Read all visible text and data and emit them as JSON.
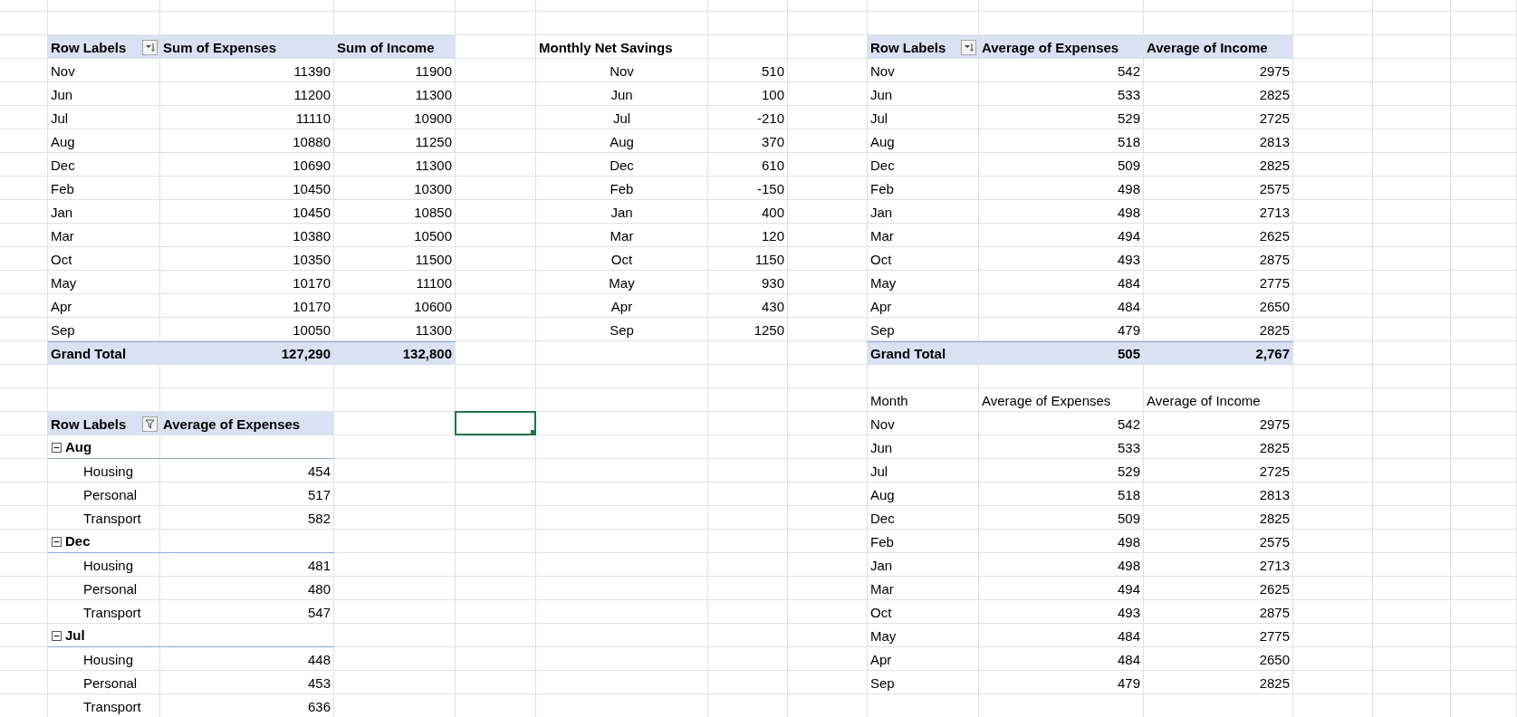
{
  "pivot_sum": {
    "columns": [
      "Row Labels",
      "Sum of Expenses",
      "Sum of Income"
    ],
    "header_button": {
      "kind": "sort"
    },
    "rows": [
      [
        "Nov",
        "11390",
        "11900"
      ],
      [
        "Jun",
        "11200",
        "11300"
      ],
      [
        "Jul",
        "11110",
        "10900"
      ],
      [
        "Aug",
        "10880",
        "11250"
      ],
      [
        "Dec",
        "10690",
        "11300"
      ],
      [
        "Feb",
        "10450",
        "10300"
      ],
      [
        "Jan",
        "10450",
        "10850"
      ],
      [
        "Mar",
        "10380",
        "10500"
      ],
      [
        "Oct",
        "10350",
        "11500"
      ],
      [
        "May",
        "10170",
        "11100"
      ],
      [
        "Apr",
        "10170",
        "10600"
      ],
      [
        "Sep",
        "10050",
        "11300"
      ]
    ],
    "total": [
      "Grand Total",
      "127,290",
      "132,800"
    ]
  },
  "net_savings": {
    "title": "Monthly Net Savings",
    "rows": [
      [
        "Nov",
        "510"
      ],
      [
        "Jun",
        "100"
      ],
      [
        "Jul",
        "-210"
      ],
      [
        "Aug",
        "370"
      ],
      [
        "Dec",
        "610"
      ],
      [
        "Feb",
        "-150"
      ],
      [
        "Jan",
        "400"
      ],
      [
        "Mar",
        "120"
      ],
      [
        "Oct",
        "1150"
      ],
      [
        "May",
        "930"
      ],
      [
        "Apr",
        "430"
      ],
      [
        "Sep",
        "1250"
      ]
    ]
  },
  "pivot_avg": {
    "columns": [
      "Row Labels",
      "Average of Expenses",
      "Average of Income"
    ],
    "header_button": {
      "kind": "sort"
    },
    "rows": [
      [
        "Nov",
        "542",
        "2975"
      ],
      [
        "Jun",
        "533",
        "2825"
      ],
      [
        "Jul",
        "529",
        "2725"
      ],
      [
        "Aug",
        "518",
        "2813"
      ],
      [
        "Dec",
        "509",
        "2825"
      ],
      [
        "Feb",
        "498",
        "2575"
      ],
      [
        "Jan",
        "498",
        "2713"
      ],
      [
        "Mar",
        "494",
        "2625"
      ],
      [
        "Oct",
        "493",
        "2875"
      ],
      [
        "May",
        "484",
        "2775"
      ],
      [
        "Apr",
        "484",
        "2650"
      ],
      [
        "Sep",
        "479",
        "2825"
      ]
    ],
    "total": [
      "Grand Total",
      "505",
      "2,767"
    ]
  },
  "pivot_category": {
    "columns": [
      "Row Labels",
      "Average of Expenses"
    ],
    "header_button": {
      "kind": "filter"
    },
    "groups": [
      {
        "label": "Aug",
        "expanded": true,
        "children": [
          [
            "Housing",
            "454"
          ],
          [
            "Personal",
            "517"
          ],
          [
            "Transport",
            "582"
          ]
        ]
      },
      {
        "label": "Dec",
        "expanded": true,
        "children": [
          [
            "Housing",
            "481"
          ],
          [
            "Personal",
            "480"
          ],
          [
            "Transport",
            "547"
          ]
        ]
      },
      {
        "label": "Jul",
        "expanded": true,
        "children": [
          [
            "Housing",
            "448"
          ],
          [
            "Personal",
            "453"
          ],
          [
            "Transport",
            "636"
          ]
        ]
      }
    ]
  },
  "month_table": {
    "columns": [
      "Month",
      "Average of Expenses",
      "Average of Income"
    ],
    "rows": [
      [
        "Nov",
        "542",
        "2975"
      ],
      [
        "Jun",
        "533",
        "2825"
      ],
      [
        "Jul",
        "529",
        "2725"
      ],
      [
        "Aug",
        "518",
        "2813"
      ],
      [
        "Dec",
        "509",
        "2825"
      ],
      [
        "Feb",
        "498",
        "2575"
      ],
      [
        "Jan",
        "498",
        "2713"
      ],
      [
        "Mar",
        "494",
        "2625"
      ],
      [
        "Oct",
        "493",
        "2875"
      ],
      [
        "May",
        "484",
        "2775"
      ],
      [
        "Apr",
        "484",
        "2650"
      ],
      [
        "Sep",
        "479",
        "2825"
      ]
    ]
  },
  "active_cell": {
    "selected": true
  }
}
